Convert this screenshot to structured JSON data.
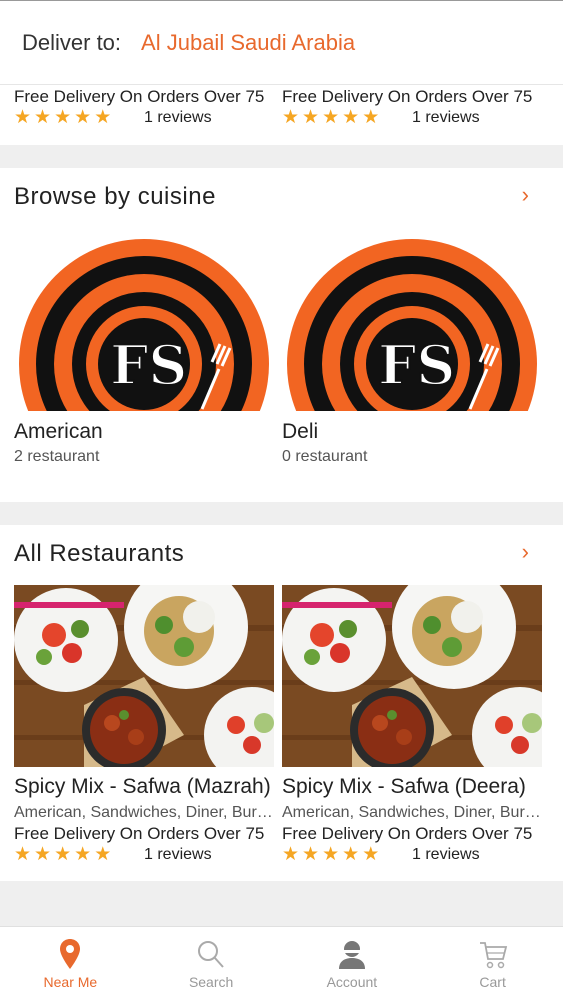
{
  "header": {
    "label": "Deliver to:",
    "location": "Al Jubail Saudi Arabia"
  },
  "top_cards": [
    {
      "promo": "Free Delivery On Orders Over 75",
      "reviews": "1 reviews",
      "stars": 5
    },
    {
      "promo": "Free Delivery On Orders Over 75",
      "reviews": "1 reviews",
      "stars": 5
    }
  ],
  "cuisine_section": {
    "title": "Browse by cuisine",
    "items": [
      {
        "name": "American",
        "count": "2 restaurant",
        "logo_text": "FS"
      },
      {
        "name": "Deli",
        "count": "0 restaurant",
        "logo_text": "FS"
      }
    ]
  },
  "restaurants_section": {
    "title": "All Restaurants",
    "items": [
      {
        "name": "Spicy Mix - Safwa (Mazrah)",
        "cuisines": "American, Sandwiches, Diner, Burgers",
        "promo": "Free Delivery On Orders Over 75",
        "reviews": "1 reviews",
        "stars": 5
      },
      {
        "name": "Spicy Mix - Safwa (Deera)",
        "cuisines": "American, Sandwiches, Diner, Burgers",
        "promo": "Free Delivery On Orders Over 75",
        "reviews": "1 reviews",
        "stars": 5
      }
    ]
  },
  "tabs": [
    {
      "label": "Near Me",
      "icon": "location-pin-icon",
      "active": true
    },
    {
      "label": "Search",
      "icon": "search-icon",
      "active": false
    },
    {
      "label": "Account",
      "icon": "account-icon",
      "active": false
    },
    {
      "label": "Cart",
      "icon": "cart-icon",
      "active": false
    }
  ],
  "colors": {
    "accent": "#e8692d",
    "star": "#f5a623",
    "logo_orange": "#f26522",
    "logo_black": "#111111",
    "magenta_bar": "#d6246e"
  }
}
